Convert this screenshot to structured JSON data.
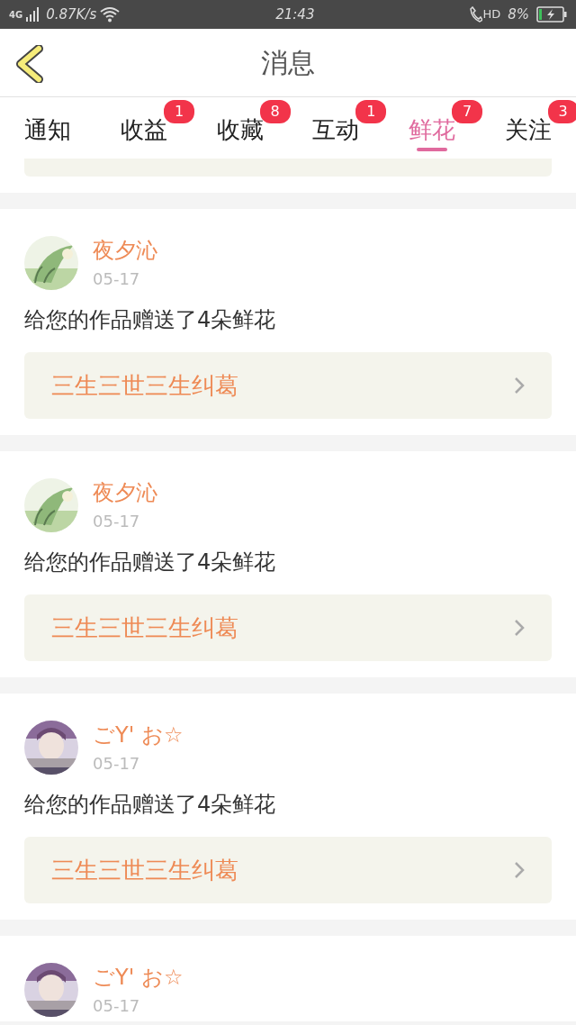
{
  "status_bar": {
    "network": "4G",
    "speed": "0.87K/s",
    "time": "21:43",
    "call_label": "HD",
    "battery": "8%",
    "charging": true
  },
  "header": {
    "title": "消息"
  },
  "tabs": [
    {
      "label": "通知",
      "selected": false
    },
    {
      "label": "收益",
      "selected": false,
      "badge": "1"
    },
    {
      "label": "收藏",
      "selected": false,
      "badge": "8"
    },
    {
      "label": "互动",
      "selected": false,
      "badge": "1"
    },
    {
      "label": "鲜花",
      "selected": true,
      "badge": "7"
    },
    {
      "label": "关注",
      "selected": false,
      "badge": "3"
    }
  ],
  "messages": [
    {
      "kind": "link-stub"
    },
    {
      "kind": "full",
      "user": "夜夕沁",
      "date": "05-17",
      "text": "给您的作品赠送了4朵鲜花",
      "work": "三生三世三生纠葛"
    },
    {
      "kind": "full",
      "user": "夜夕沁",
      "date": "05-17",
      "text": "给您的作品赠送了4朵鲜花",
      "work": "三生三世三生纠葛"
    },
    {
      "kind": "full",
      "user": "ごY' お☆",
      "date": "05-17",
      "text": "给您的作品赠送了4朵鲜花",
      "work": "三生三世三生纠葛"
    },
    {
      "kind": "header-only",
      "user": "ごY' お☆",
      "date": "05-17"
    }
  ]
}
